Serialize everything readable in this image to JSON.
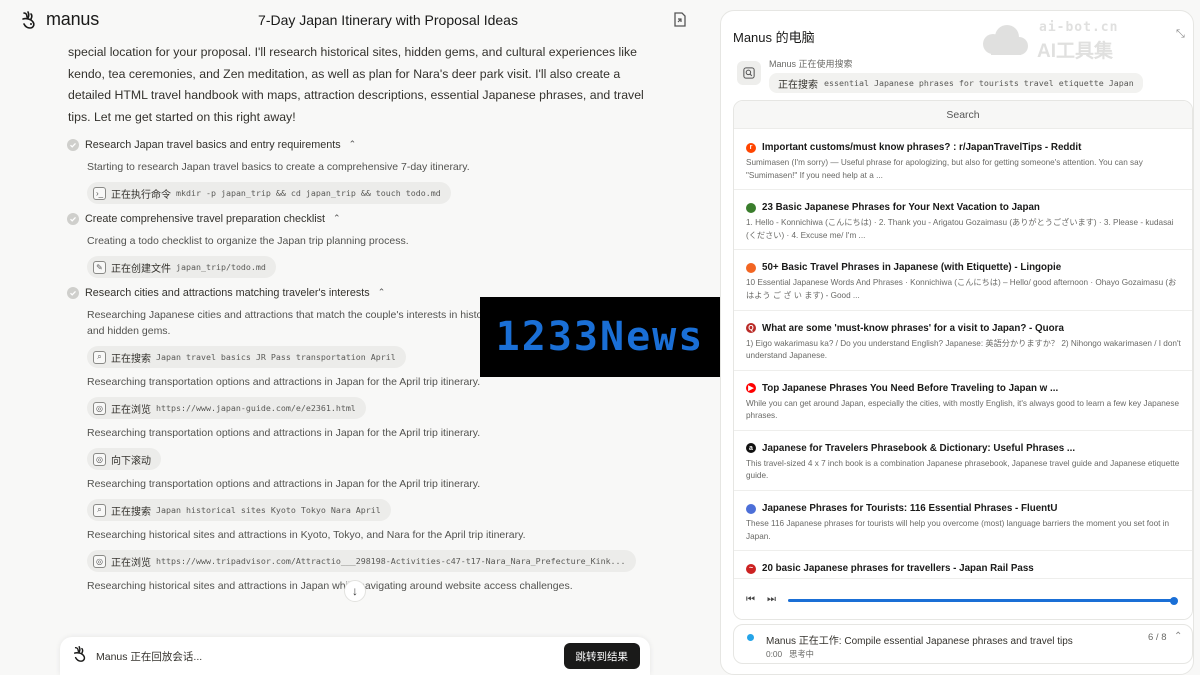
{
  "header": {
    "brand": "manus",
    "title": "7-Day Japan Itinerary with Proposal Ideas"
  },
  "intro": "special location for your proposal. I'll research historical sites, hidden gems, and cultural experiences like kendo, tea ceremonies, and Zen meditation, as well as plan for Nara's deer park visit. I'll also create a detailed HTML travel handbook with maps, attraction descriptions, essential Japanese phrases, and travel tips. Let me get started on this right away!",
  "steps": [
    {
      "title": "Research Japan travel basics and entry requirements",
      "entries": [
        {
          "desc": "Starting to research Japan travel basics to create a comprehensive 7-day itinerary.",
          "tool": {
            "icon": "terminal-icon",
            "verb": "正在执行命令",
            "arg": "mkdir -p japan_trip && cd japan_trip && touch todo.md"
          }
        }
      ]
    },
    {
      "title": "Create comprehensive travel preparation checklist",
      "entries": [
        {
          "desc": "Creating a todo checklist to organize the Japan trip planning process.",
          "tool": {
            "icon": "edit-icon",
            "verb": "正在创建文件",
            "arg": "japan_trip/todo.md"
          }
        }
      ]
    },
    {
      "title": "Research cities and attractions matching traveler's interests",
      "entries": [
        {
          "desc": "Researching Japanese cities and attractions that match the couple's interests in histo",
          "desc2": "and hidden gems.",
          "tool": {
            "icon": "search-icon",
            "verb": "正在搜索",
            "arg": "Japan travel basics JR Pass transportation April"
          }
        },
        {
          "desc": "Researching transportation options and attractions in Japan for the April trip itinerary.",
          "tool": {
            "icon": "browser-icon",
            "verb": "正在浏览",
            "arg": "https://www.japan-guide.com/e/e2361.html"
          }
        },
        {
          "desc": "Researching transportation options and attractions in Japan for the April trip itinerary.",
          "tool": {
            "icon": "browser-icon",
            "verb": "向下滚动",
            "arg": ""
          }
        },
        {
          "desc": "Researching transportation options and attractions in Japan for the April trip itinerary.",
          "tool": {
            "icon": "search-icon",
            "verb": "正在搜索",
            "arg": "Japan historical sites Kyoto Tokyo Nara April"
          }
        },
        {
          "desc": "Researching historical sites and attractions in Kyoto, Tokyo, and Nara for the April trip itinerary.",
          "tool": {
            "icon": "browser-icon",
            "verb": "正在浏览",
            "arg": "https://www.tripadvisor.com/Attractio___298198-Activities-c47-t17-Nara_Nara_Prefecture_Kink..."
          }
        },
        {
          "desc": "Researching historical sites and attractions in Japan while navigating around website access challenges.",
          "tool": null
        }
      ]
    }
  ],
  "bottom_bar": {
    "status": "Manus 正在回放会话...",
    "button": "跳转到结果"
  },
  "watermark_1233": "1233News",
  "watermark_ai": {
    "line1": "ai-bot.cn",
    "line2": "AI工具集"
  },
  "right_panel": {
    "title": "Manus 的电脑",
    "tool_label": "Manus 正在使用搜索",
    "tool_verb": "正在搜索",
    "tool_query": "essential Japanese phrases for tourists travel etiquette Japan",
    "browser_header": "Search",
    "results": [
      {
        "icon_color": "#ff4500",
        "icon_glyph": "r",
        "title": "Important customs/must know phrases? : r/JapanTravelTips - Reddit",
        "snippet": "Sumimasen (I'm sorry) — Useful phrase for apologizing, but also for getting someone's attention. You can say \"Sumimasen!\" If you need help at a ..."
      },
      {
        "icon_color": "#3a7d2c",
        "icon_glyph": "",
        "title": "23 Basic Japanese Phrases for Your Next Vacation to Japan",
        "snippet": "1. Hello - Konnichiwa (こんにちは) · 2. Thank you - Arigatou Gozaimasu (ありがとうございます) · 3. Please - kudasai (ください) · 4. Excuse me/ I'm ..."
      },
      {
        "icon_color": "#f26522",
        "icon_glyph": "",
        "title": "50+ Basic Travel Phrases in Japanese (with Etiquette) - Lingopie",
        "snippet": "10 Essential Japanese Words And Phrases · Konnichiwa (こんにちは) – Hello/ good afternoon · Ohayo Gozaimasu (おはよう ご ざ い ます) - Good ..."
      },
      {
        "icon_color": "#b92b27",
        "icon_glyph": "Q",
        "title": "What are some 'must-know phrases' for a visit to Japan? - Quora",
        "snippet": "1) Eigo wakarimasu ka? / Do you understand English? Japanese: 英語分かりますか？  2) Nihongo wakarimasen / I don't understand Japanese."
      },
      {
        "icon_color": "#ff0000",
        "icon_glyph": "▶",
        "title": "Top Japanese Phrases You Need Before Traveling to Japan w ...",
        "snippet": "While you can get around Japan, especially the cities, with mostly English, it's always good to learn a few key Japanese phrases."
      },
      {
        "icon_color": "#111111",
        "icon_glyph": "a",
        "title": "Japanese for Travelers Phrasebook & Dictionary: Useful Phrases ...",
        "snippet": "This travel-sized 4 x 7 inch book is a combination Japanese phrasebook, Japanese travel guide and Japanese etiquette guide."
      },
      {
        "icon_color": "#4c6fd8",
        "icon_glyph": "",
        "title": "Japanese Phrases for Tourists: 116 Essential Phrases - FluentU",
        "snippet": "These 116 Japanese phrases for tourists will help you overcome (most) language barriers the moment you set foot in Japan."
      },
      {
        "icon_color": "#cc2222",
        "icon_glyph": "~",
        "title": "20 basic Japanese phrases for travellers - Japan Rail Pass",
        "snippet": ""
      }
    ],
    "playback_progress": 0.99,
    "task": {
      "title": "Manus 正在工作: Compile essential Japanese phrases and travel tips",
      "time": "0:00",
      "state": "思考中",
      "count": "6 / 8"
    }
  }
}
